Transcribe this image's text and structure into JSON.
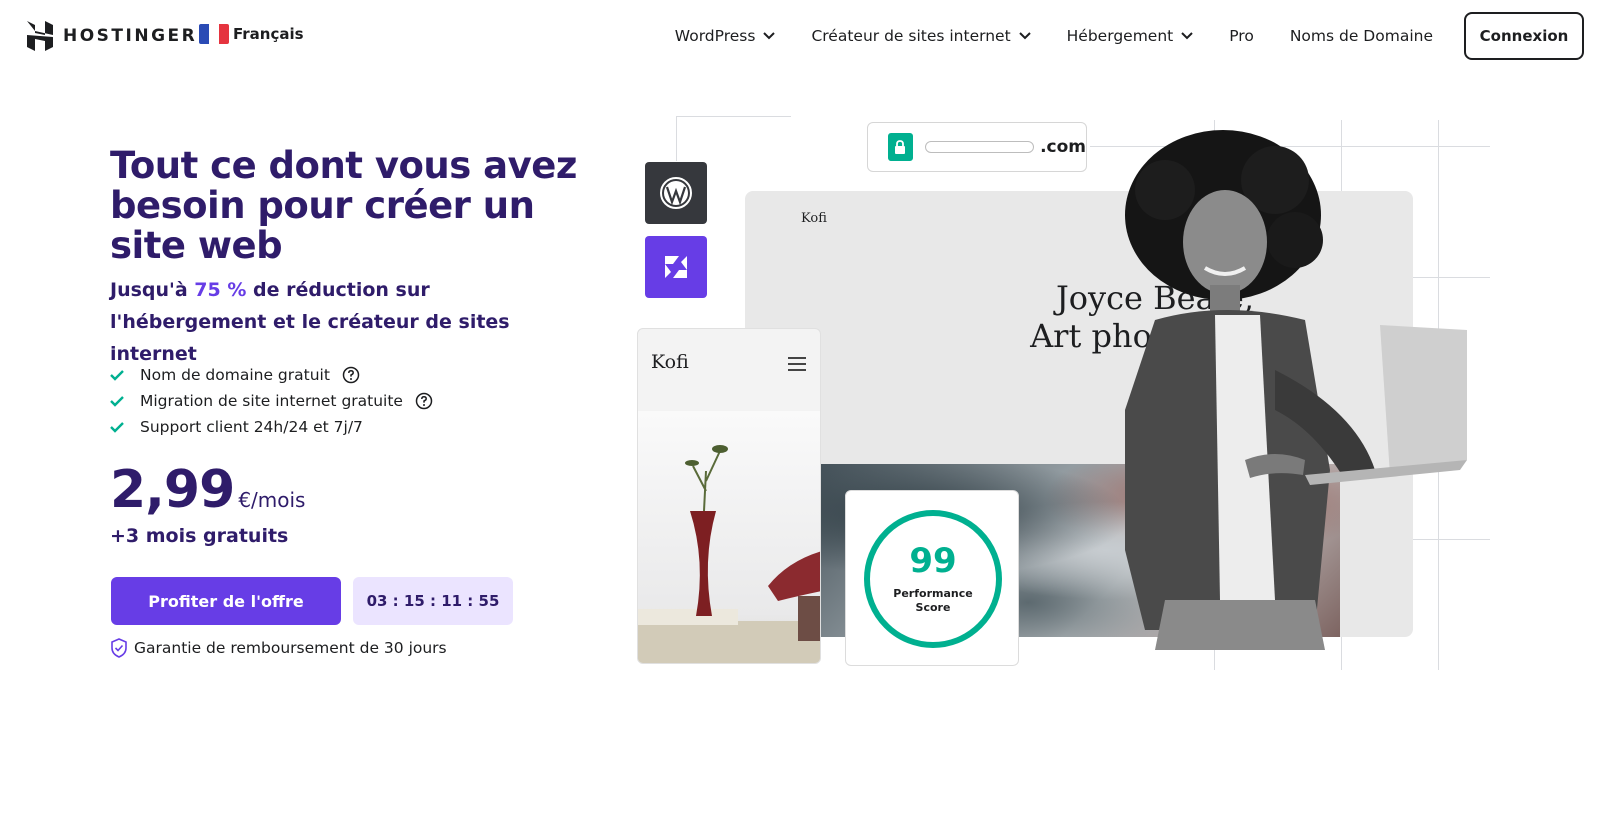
{
  "header": {
    "logo_text": "HOSTINGER",
    "language": "Français",
    "nav": [
      {
        "label": "WordPress",
        "dropdown": true
      },
      {
        "label": "Créateur de sites internet",
        "dropdown": true
      },
      {
        "label": "Hébergement",
        "dropdown": true
      },
      {
        "label": "Pro",
        "dropdown": false
      },
      {
        "label": "Noms de Domaine",
        "dropdown": false
      }
    ],
    "login_label": "Connexion"
  },
  "hero": {
    "title": "Tout ce dont vous avez besoin pour créer un site web",
    "subtitle_before": "Jusqu'à ",
    "subtitle_accent": "75 %",
    "subtitle_after": " de réduction sur l'hébergement et le créateur de sites internet",
    "features": [
      {
        "label": "Nom de domaine gratuit",
        "help": true
      },
      {
        "label": "Migration de site internet gratuite",
        "help": true
      },
      {
        "label": "Support client 24h/24 et 7j/7",
        "help": false
      }
    ],
    "price": "2,99",
    "price_unit": "€/mois",
    "bonus": "+3 mois gratuits",
    "cta_label": "Profiter de l'offre",
    "timer": "03 : 15 : 11 : 55",
    "guarantee": "Garantie de remboursement de 30 jours"
  },
  "illustration": {
    "domain_suffix": ".com",
    "desktop_brand": "Kofi",
    "desktop_heading_line1": "Joyce Beale,",
    "desktop_heading_line2": "Art photograph",
    "mobile_brand": "Kofi",
    "perf_score": "99",
    "perf_label_line1": "Performance",
    "perf_label_line2": "Score"
  },
  "colors": {
    "accent": "#673de6",
    "heading": "#2f1c6a",
    "success": "#00b090",
    "timer_bg": "#ebe4ff"
  },
  "icons": {
    "checks": "check-icon",
    "help": "question-circle-icon",
    "shield": "shield-check-icon",
    "lock": "lock-icon",
    "wordpress": "wordpress-icon",
    "builder": "hostinger-builder-icon"
  }
}
